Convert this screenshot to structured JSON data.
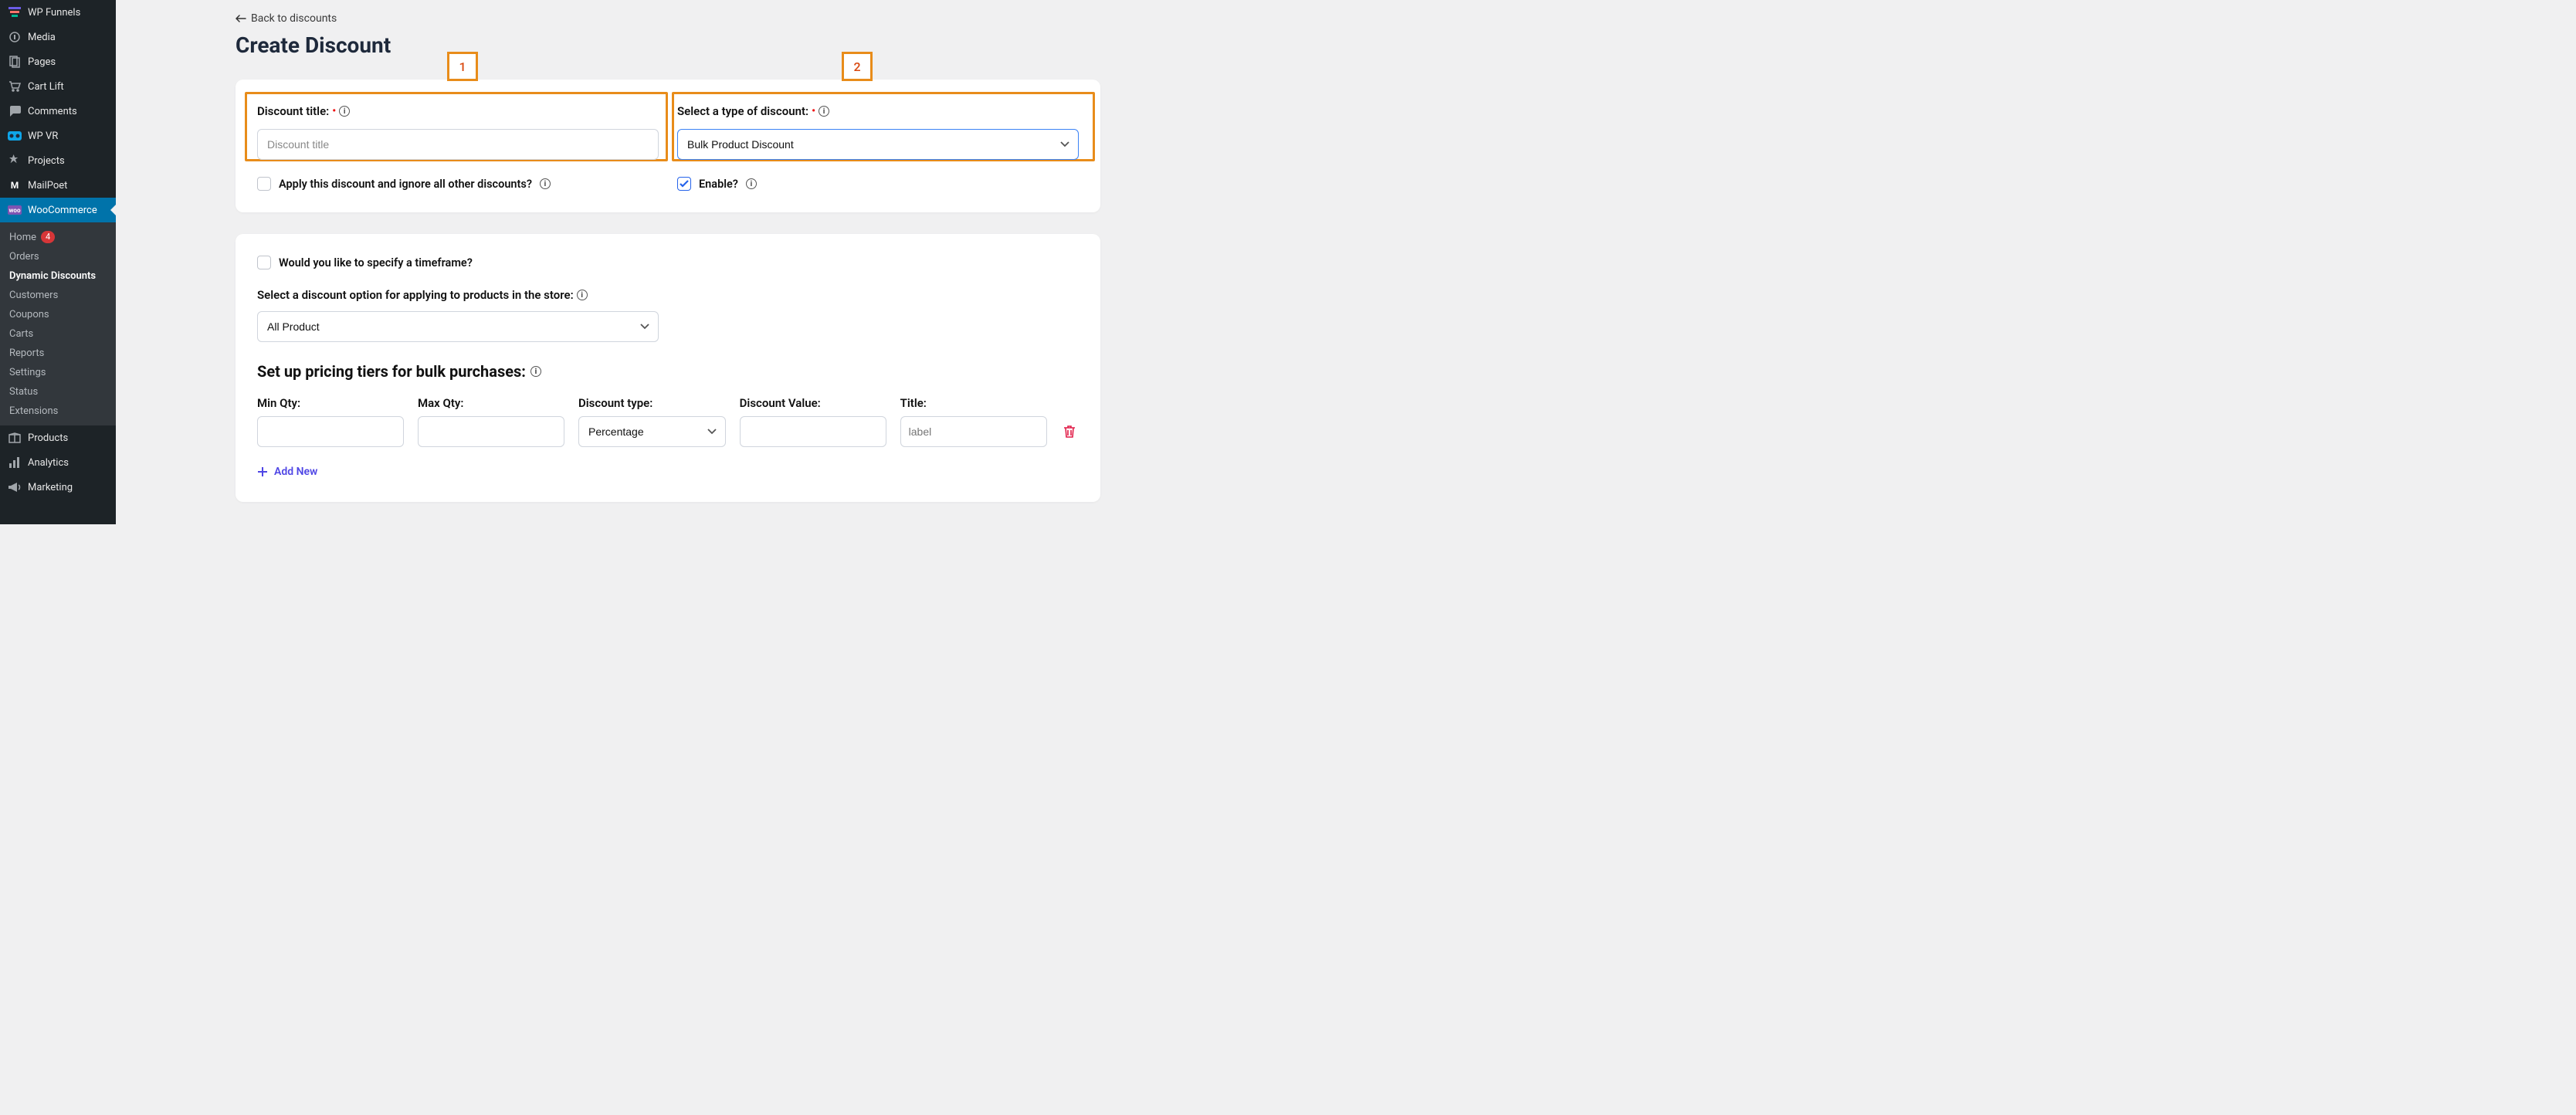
{
  "sidebar": {
    "items": [
      {
        "label": "WP Funnels",
        "icon": "funnel"
      },
      {
        "label": "Media",
        "icon": "media"
      },
      {
        "label": "Pages",
        "icon": "pages"
      },
      {
        "label": "Cart Lift",
        "icon": "cart"
      },
      {
        "label": "Comments",
        "icon": "comment"
      },
      {
        "label": "WP VR",
        "icon": "vr"
      },
      {
        "label": "Projects",
        "icon": "pin"
      },
      {
        "label": "MailPoet",
        "icon": "mailpoet"
      },
      {
        "label": "WooCommerce",
        "icon": "woo",
        "active": true
      }
    ],
    "submenu": [
      {
        "label": "Home",
        "badge": "4"
      },
      {
        "label": "Orders"
      },
      {
        "label": "Dynamic Discounts",
        "current": true
      },
      {
        "label": "Customers"
      },
      {
        "label": "Coupons"
      },
      {
        "label": "Carts"
      },
      {
        "label": "Reports"
      },
      {
        "label": "Settings"
      },
      {
        "label": "Status"
      },
      {
        "label": "Extensions"
      }
    ],
    "items_after": [
      {
        "label": "Products",
        "icon": "box"
      },
      {
        "label": "Analytics",
        "icon": "analytics"
      },
      {
        "label": "Marketing",
        "icon": "megaphone"
      }
    ]
  },
  "main": {
    "back_label": "Back to discounts",
    "title": "Create Discount",
    "callouts": {
      "one": "1",
      "two": "2"
    },
    "discount_title": {
      "label": "Discount title:",
      "placeholder": "Discount title"
    },
    "discount_type": {
      "label": "Select a type of discount:",
      "value": "Bulk Product Discount"
    },
    "apply_ignore": {
      "label": "Apply this discount and ignore all other discounts?",
      "checked": false
    },
    "enable": {
      "label": "Enable?",
      "checked": true
    },
    "timeframe": {
      "label": "Would you like to specify a timeframe?",
      "checked": false
    },
    "apply_scope": {
      "label": "Select a discount option for applying to products in the store:",
      "value": "All Product"
    },
    "tiers": {
      "heading": "Set up pricing tiers for bulk purchases:",
      "columns": {
        "min": "Min Qty:",
        "max": "Max Qty:",
        "type": "Discount type:",
        "value": "Discount Value:",
        "title": "Title:"
      },
      "row": {
        "type_value": "Percentage",
        "title_placeholder": "label"
      },
      "add_new": "Add New"
    }
  }
}
